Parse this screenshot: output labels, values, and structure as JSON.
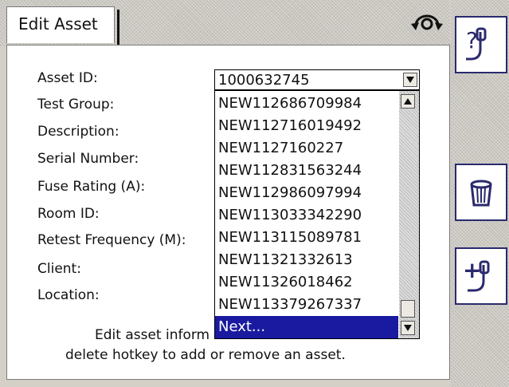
{
  "tab": {
    "title": "Edit Asset"
  },
  "fields": {
    "labels": [
      "Asset ID:",
      "Test Group:",
      "Description:",
      "Serial Number:",
      "Fuse Rating (A):",
      "Room ID:",
      "Retest Frequency (M):",
      "Client:",
      "Location:"
    ]
  },
  "asset_select": {
    "value": "1000632745"
  },
  "dropdown": {
    "options": [
      "NEW112686709984",
      "NEW112716019492",
      "NEW1127160227",
      "NEW112831563244",
      "NEW112986097994",
      "NEW113033342290",
      "NEW113115089781",
      "NEW11321332613",
      "NEW11326018462",
      "NEW113379267337",
      "Next..."
    ],
    "selected_index": 10
  },
  "footer": {
    "line1_visible": "Edit asset inform",
    "line2": "delete hotkey to add or remove an asset."
  },
  "icons": {
    "sync": "sync-icon",
    "help": "help-icon",
    "delete": "delete-bin-icon",
    "add": "add-asset-icon"
  },
  "colors": {
    "selection": "#1a1aa0",
    "button_border": "#2a2a6e"
  }
}
